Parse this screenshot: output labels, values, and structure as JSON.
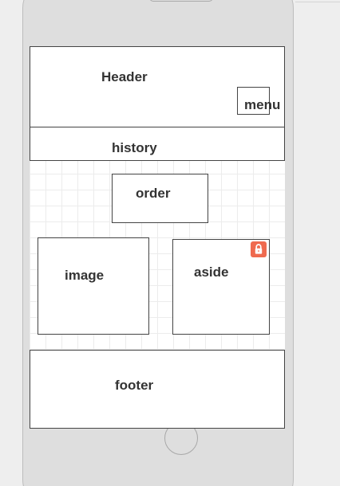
{
  "layout_preview": {
    "sections": {
      "header": {
        "label": "Header"
      },
      "menu": {
        "label": "menu"
      },
      "history": {
        "label": "history"
      },
      "order": {
        "label": "order"
      },
      "image": {
        "label": "image"
      },
      "aside": {
        "label": "aside",
        "locked": true
      },
      "footer": {
        "label": "footer"
      }
    },
    "colors": {
      "lock_badge": "#ef6a4f",
      "grid_line": "#ececec",
      "border": "#444444"
    },
    "icons": {
      "lock": "lock-icon"
    }
  }
}
